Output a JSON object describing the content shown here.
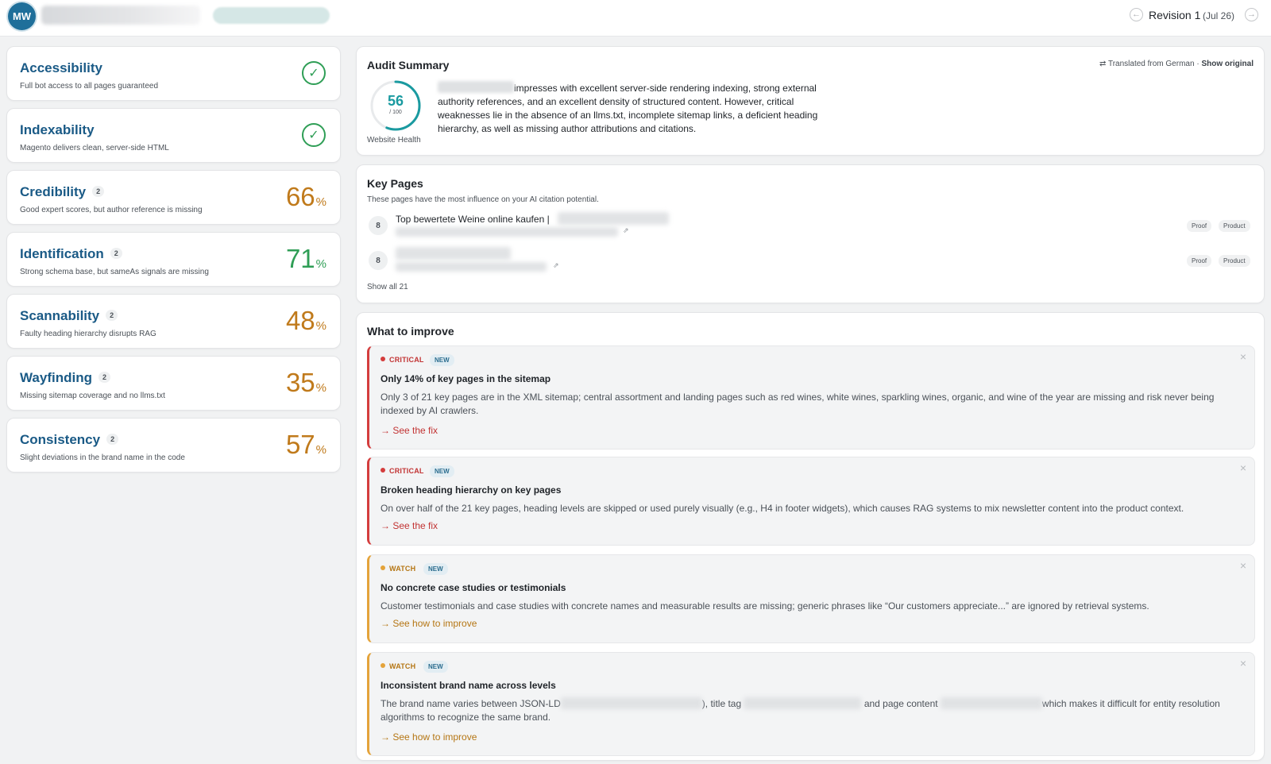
{
  "header": {
    "avatar": "MW",
    "revision_label": "Revision 1",
    "revision_date": "(Jul 26)",
    "prev_icon": "arrow-left-circle-icon",
    "next_icon": "arrow-right-circle-icon"
  },
  "metrics": [
    {
      "title": "Accessibility",
      "desc": "Full bot access to all pages guaranteed",
      "status": "pass"
    },
    {
      "title": "Indexability",
      "desc": "Magento delivers clean, server-side HTML",
      "status": "pass"
    },
    {
      "title": "Credibility",
      "count": "2",
      "desc": "Good expert scores, but author reference is missing",
      "score": "66",
      "unit": "%",
      "color": "#c07a1b"
    },
    {
      "title": "Identification",
      "count": "2",
      "desc": "Strong schema base, but sameAs signals are missing",
      "score": "71",
      "unit": "%",
      "color": "#2f9e56"
    },
    {
      "title": "Scannability",
      "count": "2",
      "desc": "Faulty heading hierarchy disrupts RAG",
      "score": "48",
      "unit": "%",
      "color": "#c07a1b"
    },
    {
      "title": "Wayfinding",
      "count": "2",
      "desc": "Missing sitemap coverage and no llms.txt",
      "score": "35",
      "unit": "%",
      "color": "#c07a1b"
    },
    {
      "title": "Consistency",
      "count": "2",
      "desc": "Slight deviations in the brand name in the code",
      "score": "57",
      "unit": "%",
      "color": "#c07a1b"
    }
  ],
  "audit": {
    "title": "Audit Summary",
    "translated": "Translated from German",
    "separator": "·",
    "show_original": "Show original",
    "score": "56",
    "score_max": "/ 100",
    "score_fraction": 0.56,
    "gauge_color": "#1a9aa0",
    "score_label": "Website Health",
    "summary": "impresses with excellent server-side rendering indexing, strong external authority references, and an excellent density of structured content. However, critical weaknesses lie in the absence of an llms.txt, incomplete sitemap links, a deficient heading hierarchy, as well as missing author attributions and citations."
  },
  "key_pages": {
    "title": "Key Pages",
    "subtitle": "These pages have the most influence on your AI citation potential.",
    "rows": [
      {
        "count": "8",
        "title": "Top bewertete Weine online kaufen |",
        "tags": [
          "Proof",
          "Product"
        ]
      },
      {
        "count": "8",
        "title": "",
        "tags": [
          "Proof",
          "Product"
        ]
      }
    ],
    "show_all": "Show all 21"
  },
  "improve": {
    "title": "What to improve",
    "issues": [
      {
        "severity": "CRITICAL",
        "badge": "NEW",
        "title": "Only 14% of key pages in the sitemap",
        "desc": "Only 3 of 21 key pages are in the XML sitemap; central assortment and landing pages such as red wines, white wines, sparkling wines, organic, and wine of the year are missing and risk never being indexed by AI crawlers.",
        "action": "See the fix"
      },
      {
        "severity": "CRITICAL",
        "badge": "NEW",
        "title": "Broken heading hierarchy on key pages",
        "desc": "On over half of the 21 key pages, heading levels are skipped or used purely visually (e.g., H4 in footer widgets), which causes RAG systems to mix newsletter content into the product context.",
        "action": "See the fix"
      },
      {
        "severity": "WATCH",
        "badge": "NEW",
        "title": "No concrete case studies or testimonials",
        "desc": "Customer testimonials and case studies with concrete names and measurable results are missing; generic phrases like “Our customers appreciate...” are ignored by retrieval systems.",
        "action": "See how to improve"
      },
      {
        "severity": "WATCH",
        "badge": "NEW",
        "title": "Inconsistent brand name across levels",
        "desc_parts": [
          "The brand name varies between JSON-LD",
          "), title tag",
          "and page content",
          "which makes it difficult for entity resolution algorithms to recognize the same brand."
        ],
        "action": "See how to improve"
      }
    ]
  },
  "colors": {
    "critical": "#d43d3d",
    "watch": "#e4a33a",
    "title_blue": "#1a5a86",
    "good": "#2f9e56"
  },
  "icons": {
    "arrow": "→",
    "close": "×",
    "check": "✓",
    "external": "⇗",
    "translate": "translate-icon"
  }
}
